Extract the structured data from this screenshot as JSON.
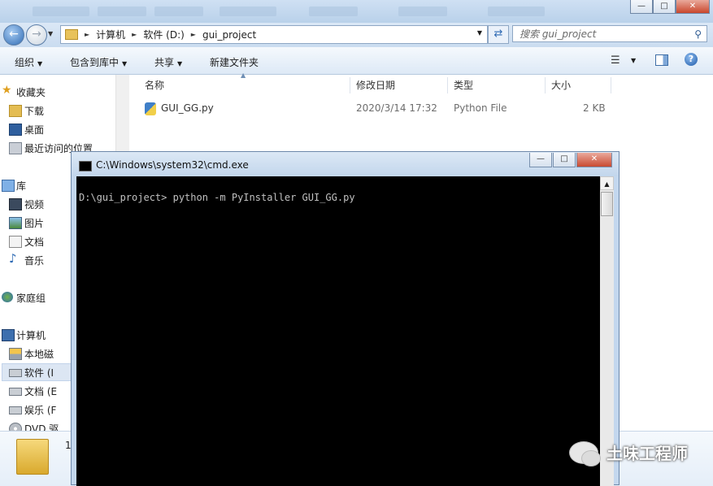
{
  "explorer": {
    "breadcrumb": [
      "计算机",
      "软件 (D:)",
      "gui_project"
    ],
    "search_placeholder": "搜索 gui_project",
    "toolbar": {
      "organize": "组织",
      "include_in_library": "包含到库中",
      "share": "共享",
      "new_folder": "新建文件夹"
    },
    "nav": {
      "favorites": "收藏夹",
      "downloads": "下载",
      "desktop": "桌面",
      "recent": "最近访问的位置",
      "libraries": "库",
      "videos": "视频",
      "pictures": "图片",
      "documents": "文档",
      "music": "音乐",
      "homegroup": "家庭组",
      "computer": "计算机",
      "drive_c": "本地磁",
      "drive_d": "软件 (I",
      "drive_e": "文档 (E",
      "drive_f": "娱乐 (F",
      "dvd": "DVD 驱"
    },
    "columns": {
      "name": "名称",
      "modified": "修改日期",
      "type": "类型",
      "size": "大小"
    },
    "files": [
      {
        "name": "GUI_GG.py",
        "modified": "2020/3/14 17:32",
        "type": "Python File",
        "size": "2 KB"
      }
    ],
    "details_count": "1"
  },
  "cmd": {
    "title": "C:\\Windows\\system32\\cmd.exe",
    "line": "D:\\gui_project> python -m PyInstaller GUI_GG.py"
  },
  "watermark": {
    "text": "土味工程师"
  }
}
